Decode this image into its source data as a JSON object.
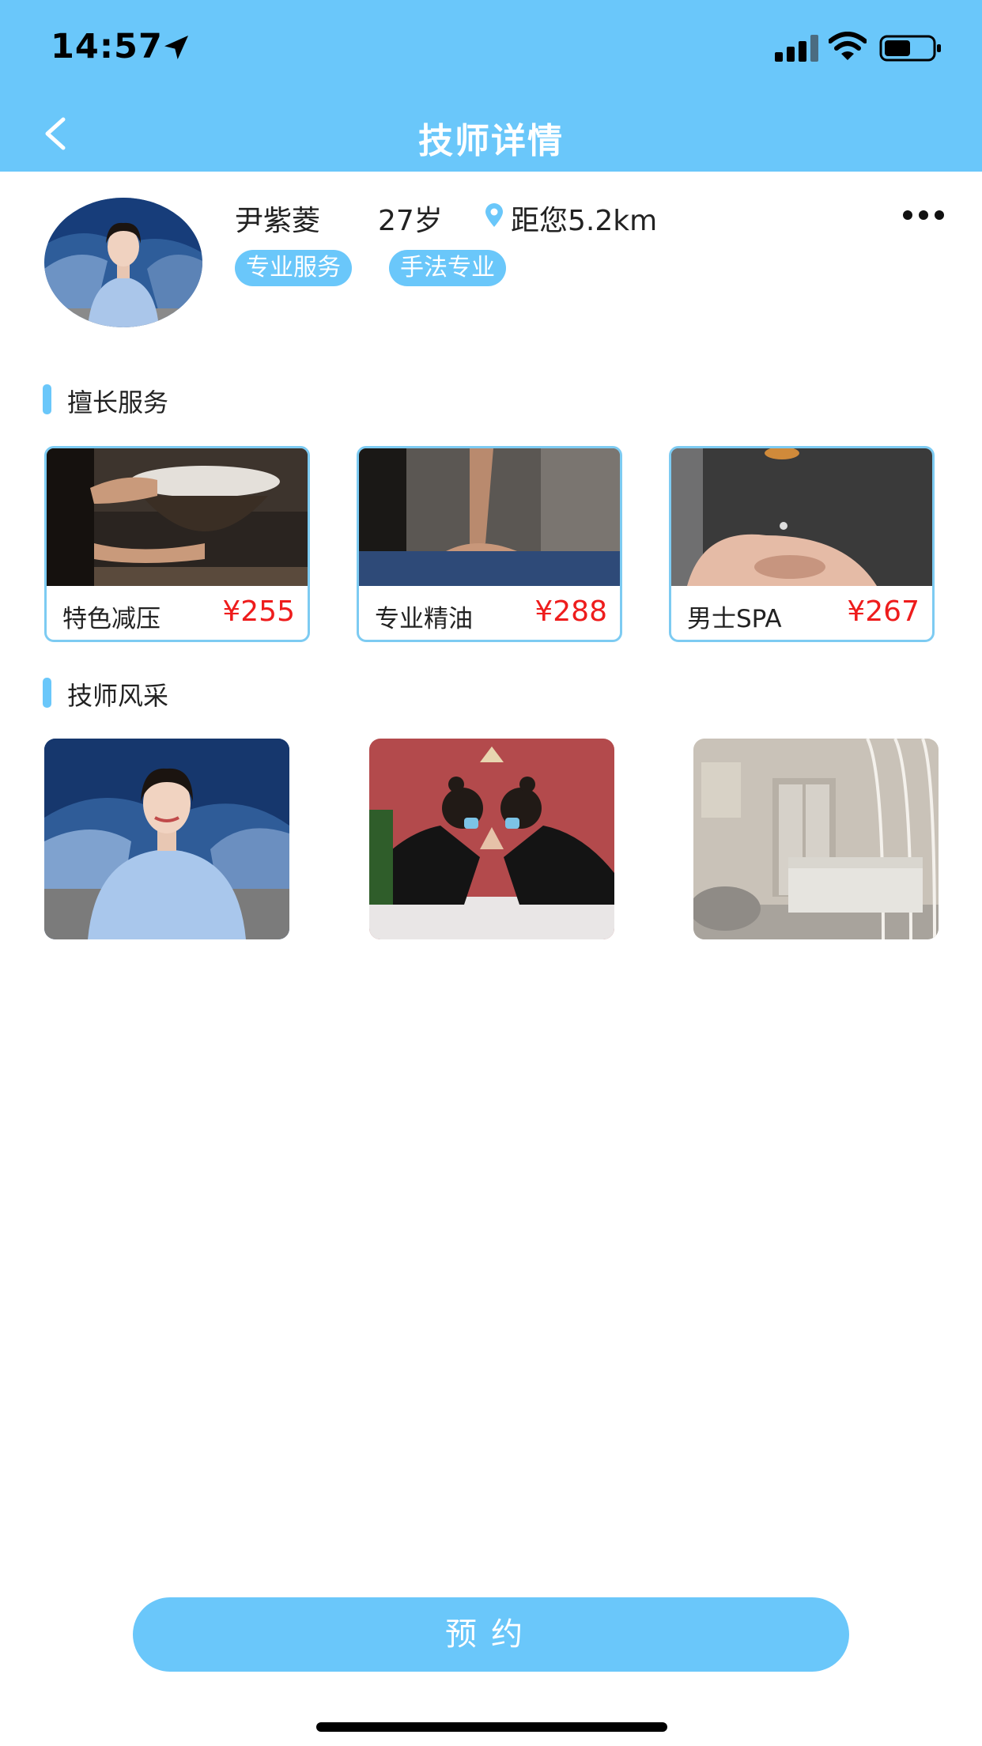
{
  "status_bar": {
    "time": "14:57"
  },
  "header": {
    "title": "技师详情"
  },
  "profile": {
    "name": "尹紫菱",
    "age": "27岁",
    "distance": "距您5.2km",
    "tags": [
      "专业服务",
      "手法专业"
    ]
  },
  "services_section": {
    "title": "擅长服务",
    "items": [
      {
        "name": "特色减压",
        "price": "¥255"
      },
      {
        "name": "专业精油",
        "price": "¥288"
      },
      {
        "name": "男士SPA",
        "price": "¥267"
      }
    ]
  },
  "gallery_section": {
    "title": "技师风采"
  },
  "actions": {
    "book_label": "预约"
  },
  "colors": {
    "accent": "#6ac7fa",
    "price": "#ee1c1c",
    "card_border": "#7dcbf2"
  },
  "icons": [
    "location-arrow-icon",
    "signal-icon",
    "wifi-icon",
    "battery-icon",
    "back-arrow-icon",
    "location-pin-icon",
    "more-dots-icon"
  ]
}
